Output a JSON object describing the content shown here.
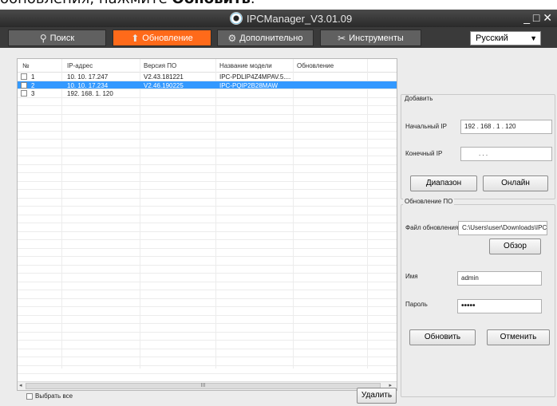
{
  "caption": {
    "prefix": "обновления, нажмите ",
    "bold": "Обновить",
    "suffix": "."
  },
  "window": {
    "title": "IPCManager_V3.01.09",
    "controls": "_ □ ✕"
  },
  "tabs": [
    {
      "label": "Поиск",
      "icon": "search-icon",
      "glyph": "⚲"
    },
    {
      "label": "Обновление",
      "icon": "upgrade-icon",
      "glyph": "⬆"
    },
    {
      "label": "Дополнительно",
      "icon": "settings-icon",
      "glyph": "⚙"
    },
    {
      "label": "Инструменты",
      "icon": "tools-icon",
      "glyph": "✂"
    }
  ],
  "language": {
    "selected": "Русский"
  },
  "table": {
    "columns": [
      "№",
      "IP-адрес",
      "Версия ПО",
      "Название модели",
      "Обновление"
    ],
    "rows": [
      {
        "num": "1",
        "ip": "10. 10. 17.247",
        "version": "V2.43.181221",
        "model": "IPC-PDLIP4Z4MPAV.5....",
        "update": "",
        "selected": false
      },
      {
        "num": "2",
        "ip": "10. 10. 17.234",
        "version": "V2.46.190225",
        "model": "IPC-PQIP2B28MAW",
        "update": "",
        "selected": true
      },
      {
        "num": "3",
        "ip": "192. 168. 1. 120",
        "version": "",
        "model": "",
        "update": "",
        "selected": false
      }
    ],
    "scroll_glyph": "III",
    "left_arrow": "◂",
    "right_arrow": "▸"
  },
  "select_all": "Выбрать все",
  "delete_button": "Удалить",
  "add_group": {
    "title": "Добавить",
    "start_ip_label": "Начальный IP",
    "start_ip_value": "192  .  168  .   1   .  120",
    "end_ip_label": "Конечный IP",
    "end_ip_value": ".            .            .",
    "range_button": "Диапазон",
    "online_button": "Онлайн"
  },
  "fw_group": {
    "title": "Обновление ПО",
    "file_label": "Файл обновления",
    "file_value": "C:\\Users\\user\\Downloads\\IPC",
    "browse_button": "Обзор",
    "user_label": "Имя",
    "user_value": "admin",
    "password_label": "Пароль",
    "password_value": "•••••",
    "update_button": "Обновить",
    "cancel_button": "Отменить"
  },
  "colors": {
    "active_tab": "#ff6a1a",
    "selected_row": "#3399ff",
    "titlebar": "#2a2a2a"
  }
}
